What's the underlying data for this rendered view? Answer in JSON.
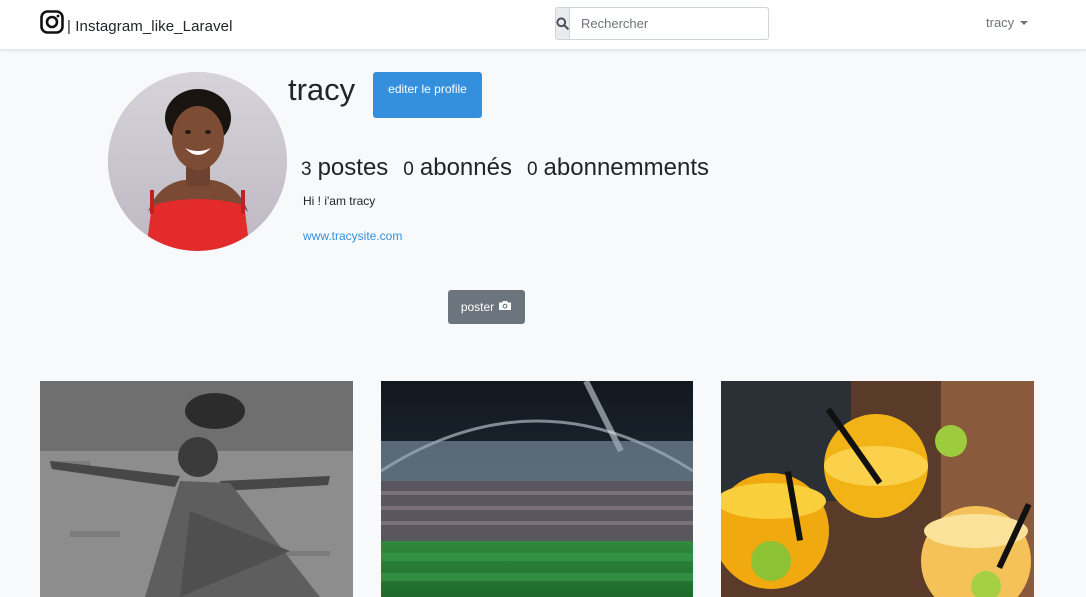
{
  "navbar": {
    "brand_icon": "instagram-icon",
    "brand_text": "| Instagram_like_Laravel",
    "search": {
      "icon": "search-icon",
      "placeholder": "Rechercher",
      "value": ""
    },
    "user_menu": {
      "label": "tracy",
      "icon": "caret-down-icon"
    }
  },
  "profile": {
    "username": "tracy",
    "edit_button": "editer le profile",
    "stats": [
      {
        "count": "3",
        "label": "postes"
      },
      {
        "count": "0",
        "label": "abonnés"
      },
      {
        "count": "0",
        "label": "abonnemments"
      }
    ],
    "bio": "Hi ! i'am tracy",
    "website": "www.tracysite.com"
  },
  "post_button": {
    "label": "poster",
    "icon": "camera-icon"
  },
  "posts": [
    {
      "subject": "girl-dancing-photo"
    },
    {
      "subject": "stadium-photo"
    },
    {
      "subject": "cocktails-photo"
    }
  ],
  "colors": {
    "primary": "#3490dc",
    "secondary": "#6c757d",
    "background": "#f8f9fa"
  }
}
